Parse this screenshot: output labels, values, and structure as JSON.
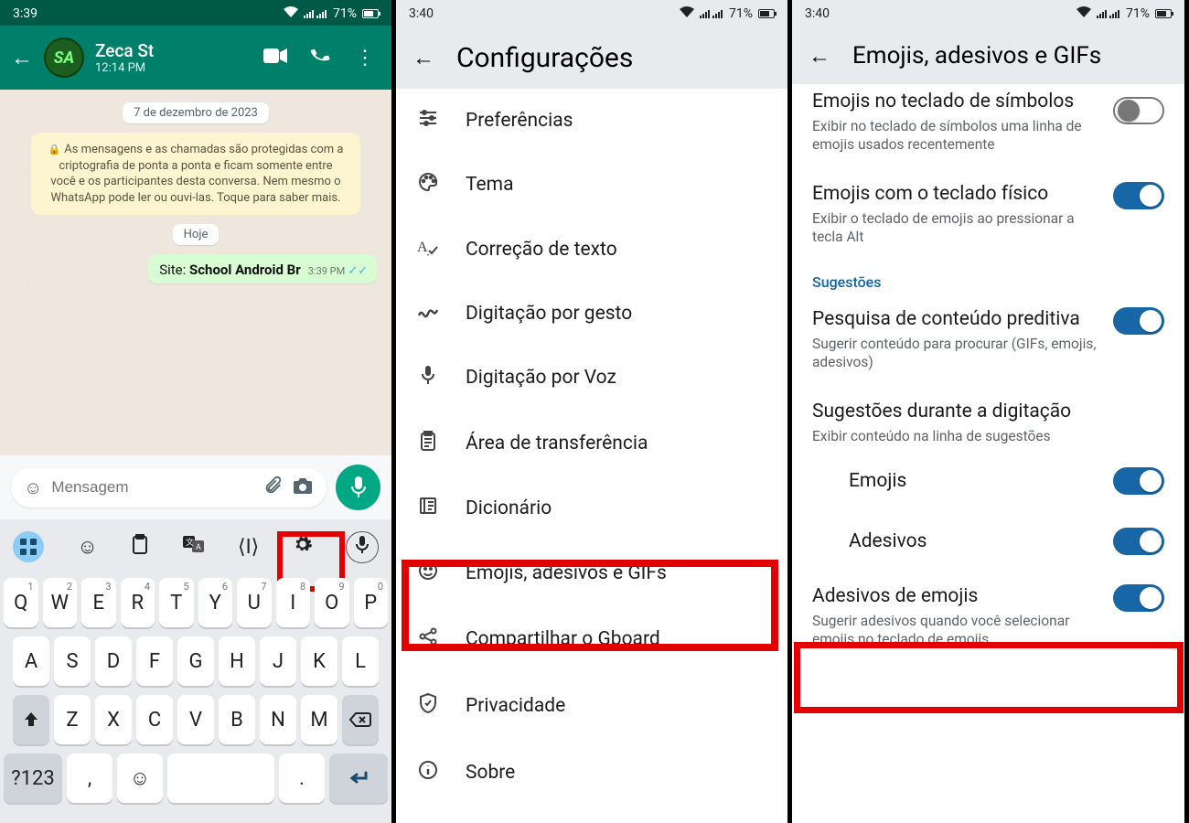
{
  "status": {
    "time1": "3:39",
    "time2": "3:40",
    "time3": "3:40",
    "battery": "71%"
  },
  "whatsapp": {
    "contact_name": "Zeca St",
    "contact_sub": "12:14 PM",
    "date_chip": "7 de dezembro de 2023",
    "encrypt_notice": "As mensagens e as chamadas são protegidas com a criptografia de ponta a ponta e ficam somente entre você e os participantes desta conversa. Nem mesmo o WhatsApp pode ler ou ouvi-las. Toque para saber mais.",
    "today_chip": "Hoje",
    "msg_prefix": "Site: ",
    "msg_bold": "School Android Br",
    "msg_time": "3:39 PM",
    "input_placeholder": "Mensagem"
  },
  "keyboard": {
    "row1": [
      "Q",
      "W",
      "E",
      "R",
      "T",
      "Y",
      "U",
      "I",
      "O",
      "P"
    ],
    "row1_sup": [
      "1",
      "2",
      "3",
      "4",
      "5",
      "6",
      "7",
      "8",
      "9",
      "0"
    ],
    "row2": [
      "A",
      "S",
      "D",
      "F",
      "G",
      "H",
      "J",
      "K",
      "L"
    ],
    "row3": [
      "Z",
      "X",
      "C",
      "V",
      "B",
      "N",
      "M"
    ],
    "symkey": "?123",
    "comma": ",",
    "period": "."
  },
  "settings": {
    "title": "Configurações",
    "items": [
      {
        "icon": "⚙",
        "label": "Preferências",
        "name": "preferences"
      },
      {
        "icon": "🎨",
        "label": "Tema",
        "name": "theme"
      },
      {
        "icon": "A✓",
        "label": "Correção de texto",
        "name": "text-correction"
      },
      {
        "icon": "〰",
        "label": "Digitação por gesto",
        "name": "gesture-typing"
      },
      {
        "icon": "🎤",
        "label": "Digitação por Voz",
        "name": "voice-typing"
      },
      {
        "icon": "📋",
        "label": "Área de transferência",
        "name": "clipboard"
      },
      {
        "icon": "📖",
        "label": "Dicionário",
        "name": "dictionary"
      },
      {
        "icon": "☺",
        "label": "Emojis, adesivos e GIFs",
        "name": "emojis-stickers-gifs"
      },
      {
        "icon": "↗",
        "label": "Compartilhar o Gboard",
        "name": "share-gboard"
      },
      {
        "icon": "🛡",
        "label": "Privacidade",
        "name": "privacy"
      },
      {
        "icon": "ⓘ",
        "label": "Sobre",
        "name": "about"
      }
    ]
  },
  "emoji_settings": {
    "title": "Emojis, adesivos e GIFs",
    "row0_title": "Emojis no teclado de símbolos",
    "row0_desc": "Exibir no teclado de símbolos uma linha de emojis usados recentemente",
    "row1_title": "Emojis com o teclado físico",
    "row1_desc": "Exibir o teclado de emojis ao pressionar a tecla Alt",
    "section": "Sugestões",
    "row2_title": "Pesquisa de conteúdo preditiva",
    "row2_desc": "Sugerir conteúdo para procurar (GIFs, emojis, adesivos)",
    "row3_title": "Sugestões durante a digitação",
    "row3_desc": "Exibir conteúdo na linha de sugestões",
    "sub_emojis": "Emojis",
    "sub_adesivos": "Adesivos",
    "row4_title": "Adesivos de emojis",
    "row4_desc": "Sugerir adesivos quando você selecionar emojis no teclado de emojis"
  }
}
